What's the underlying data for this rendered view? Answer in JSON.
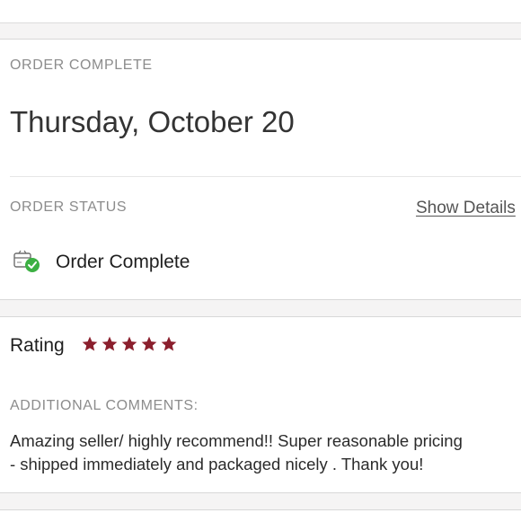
{
  "order": {
    "complete_label": "ORDER COMPLETE",
    "date": "Thursday, October 20",
    "status_label": "ORDER STATUS",
    "show_details": "Show Details",
    "status_text": "Order Complete"
  },
  "rating": {
    "label": "Rating",
    "stars": 5,
    "max_stars": 5,
    "star_color": "#8b1f2d",
    "comments_label": "ADDITIONAL COMMENTS:",
    "comment": "Amazing seller/ highly recommend!! Super reasonable pricing\n- shipped immediately and packaged nicely . Thank you!"
  },
  "icons": {
    "status": "package-check-icon",
    "star": "star-icon"
  },
  "colors": {
    "success_green": "#3cb043",
    "label_gray": "#8c8c8c",
    "page_bg": "#f5f4f4"
  }
}
